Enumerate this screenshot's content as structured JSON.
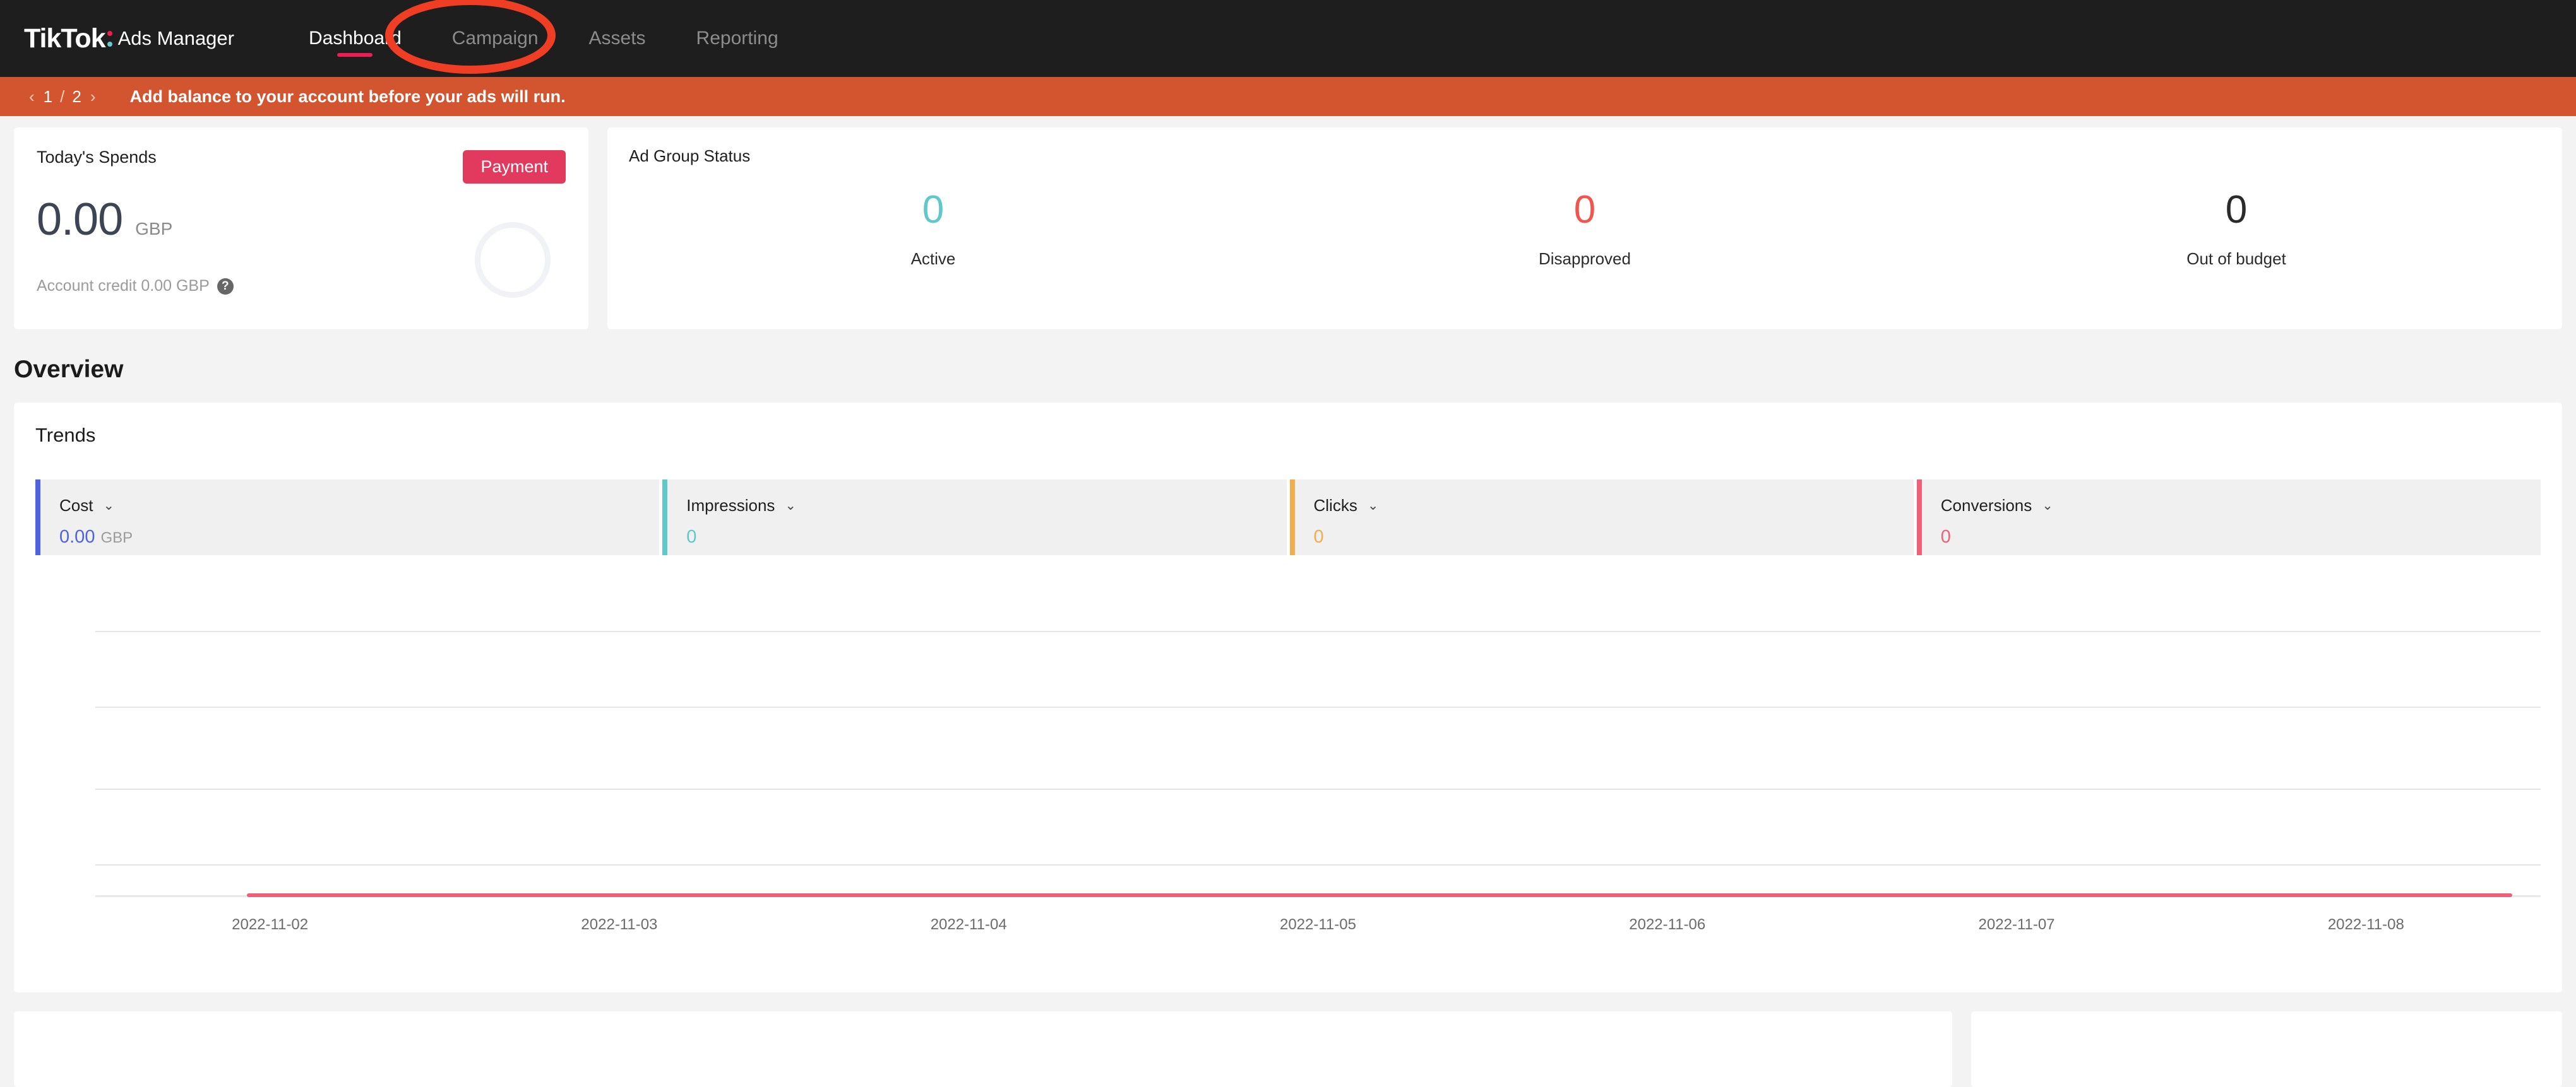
{
  "header": {
    "brand_name": "TikTok",
    "brand_subtitle": "Ads Manager",
    "nav_items": [
      {
        "label": "Dashboard",
        "active": true
      },
      {
        "label": "Campaign",
        "active": false
      },
      {
        "label": "Assets",
        "active": false
      },
      {
        "label": "Reporting",
        "active": false
      }
    ],
    "annotation": {
      "shape": "ellipse",
      "color": "#ef3e23",
      "targets": "Campaign"
    },
    "accent_underline_color": "#ee1d52"
  },
  "alert": {
    "prev_icon": "chevron-left-icon",
    "next_icon": "chevron-right-icon",
    "current_page": "1",
    "separator": "/",
    "total_pages": "2",
    "message": "Add balance to your account before your ads will run.",
    "background": "#d2552f"
  },
  "spends": {
    "title": "Today's Spends",
    "payment_label": "Payment",
    "payment_color": "#e13a5e",
    "amount": "0.00",
    "currency": "GBP",
    "credit_text": "Account credit 0.00 GBP",
    "help_icon": "question-mark-icon",
    "ring_color": "#f0f2f6"
  },
  "ad_group_status": {
    "title": "Ad Group Status",
    "metrics": [
      {
        "value": "0",
        "label": "Active",
        "color": "#5ec8cb"
      },
      {
        "value": "0",
        "label": "Disapproved",
        "color": "#f1554c"
      },
      {
        "value": "0",
        "label": "Out of budget",
        "color": "#2b2b2b"
      }
    ]
  },
  "overview": {
    "heading": "Overview",
    "trends_title": "Trends",
    "metric_tabs": [
      {
        "label": "Cost",
        "value": "0.00",
        "unit": "GBP",
        "color": "#4f63e0",
        "caret": "chevron-down-icon"
      },
      {
        "label": "Impressions",
        "value": "0",
        "unit": "",
        "color": "#5ec8cb",
        "caret": "chevron-down-icon"
      },
      {
        "label": "Clicks",
        "value": "0",
        "unit": "",
        "color": "#f2ad4e",
        "caret": "chevron-down-icon"
      },
      {
        "label": "Conversions",
        "value": "0",
        "unit": "",
        "color": "#ef5f78",
        "caret": "chevron-down-icon"
      }
    ]
  },
  "chart_data": {
    "type": "line",
    "title": "Trends",
    "xlabel": "",
    "ylabel": "",
    "grid": true,
    "legend_position": "none",
    "x": [
      "2022-11-02",
      "2022-11-03",
      "2022-11-04",
      "2022-11-05",
      "2022-11-06",
      "2022-11-07",
      "2022-11-08"
    ],
    "series": [
      {
        "name": "Conversions",
        "color": "#ef5f78",
        "values": [
          0,
          0,
          0,
          0,
          0,
          0,
          0
        ]
      }
    ],
    "ylim": [
      0,
      1
    ],
    "gridline_count": 4,
    "axis_tick_labels_y": []
  }
}
